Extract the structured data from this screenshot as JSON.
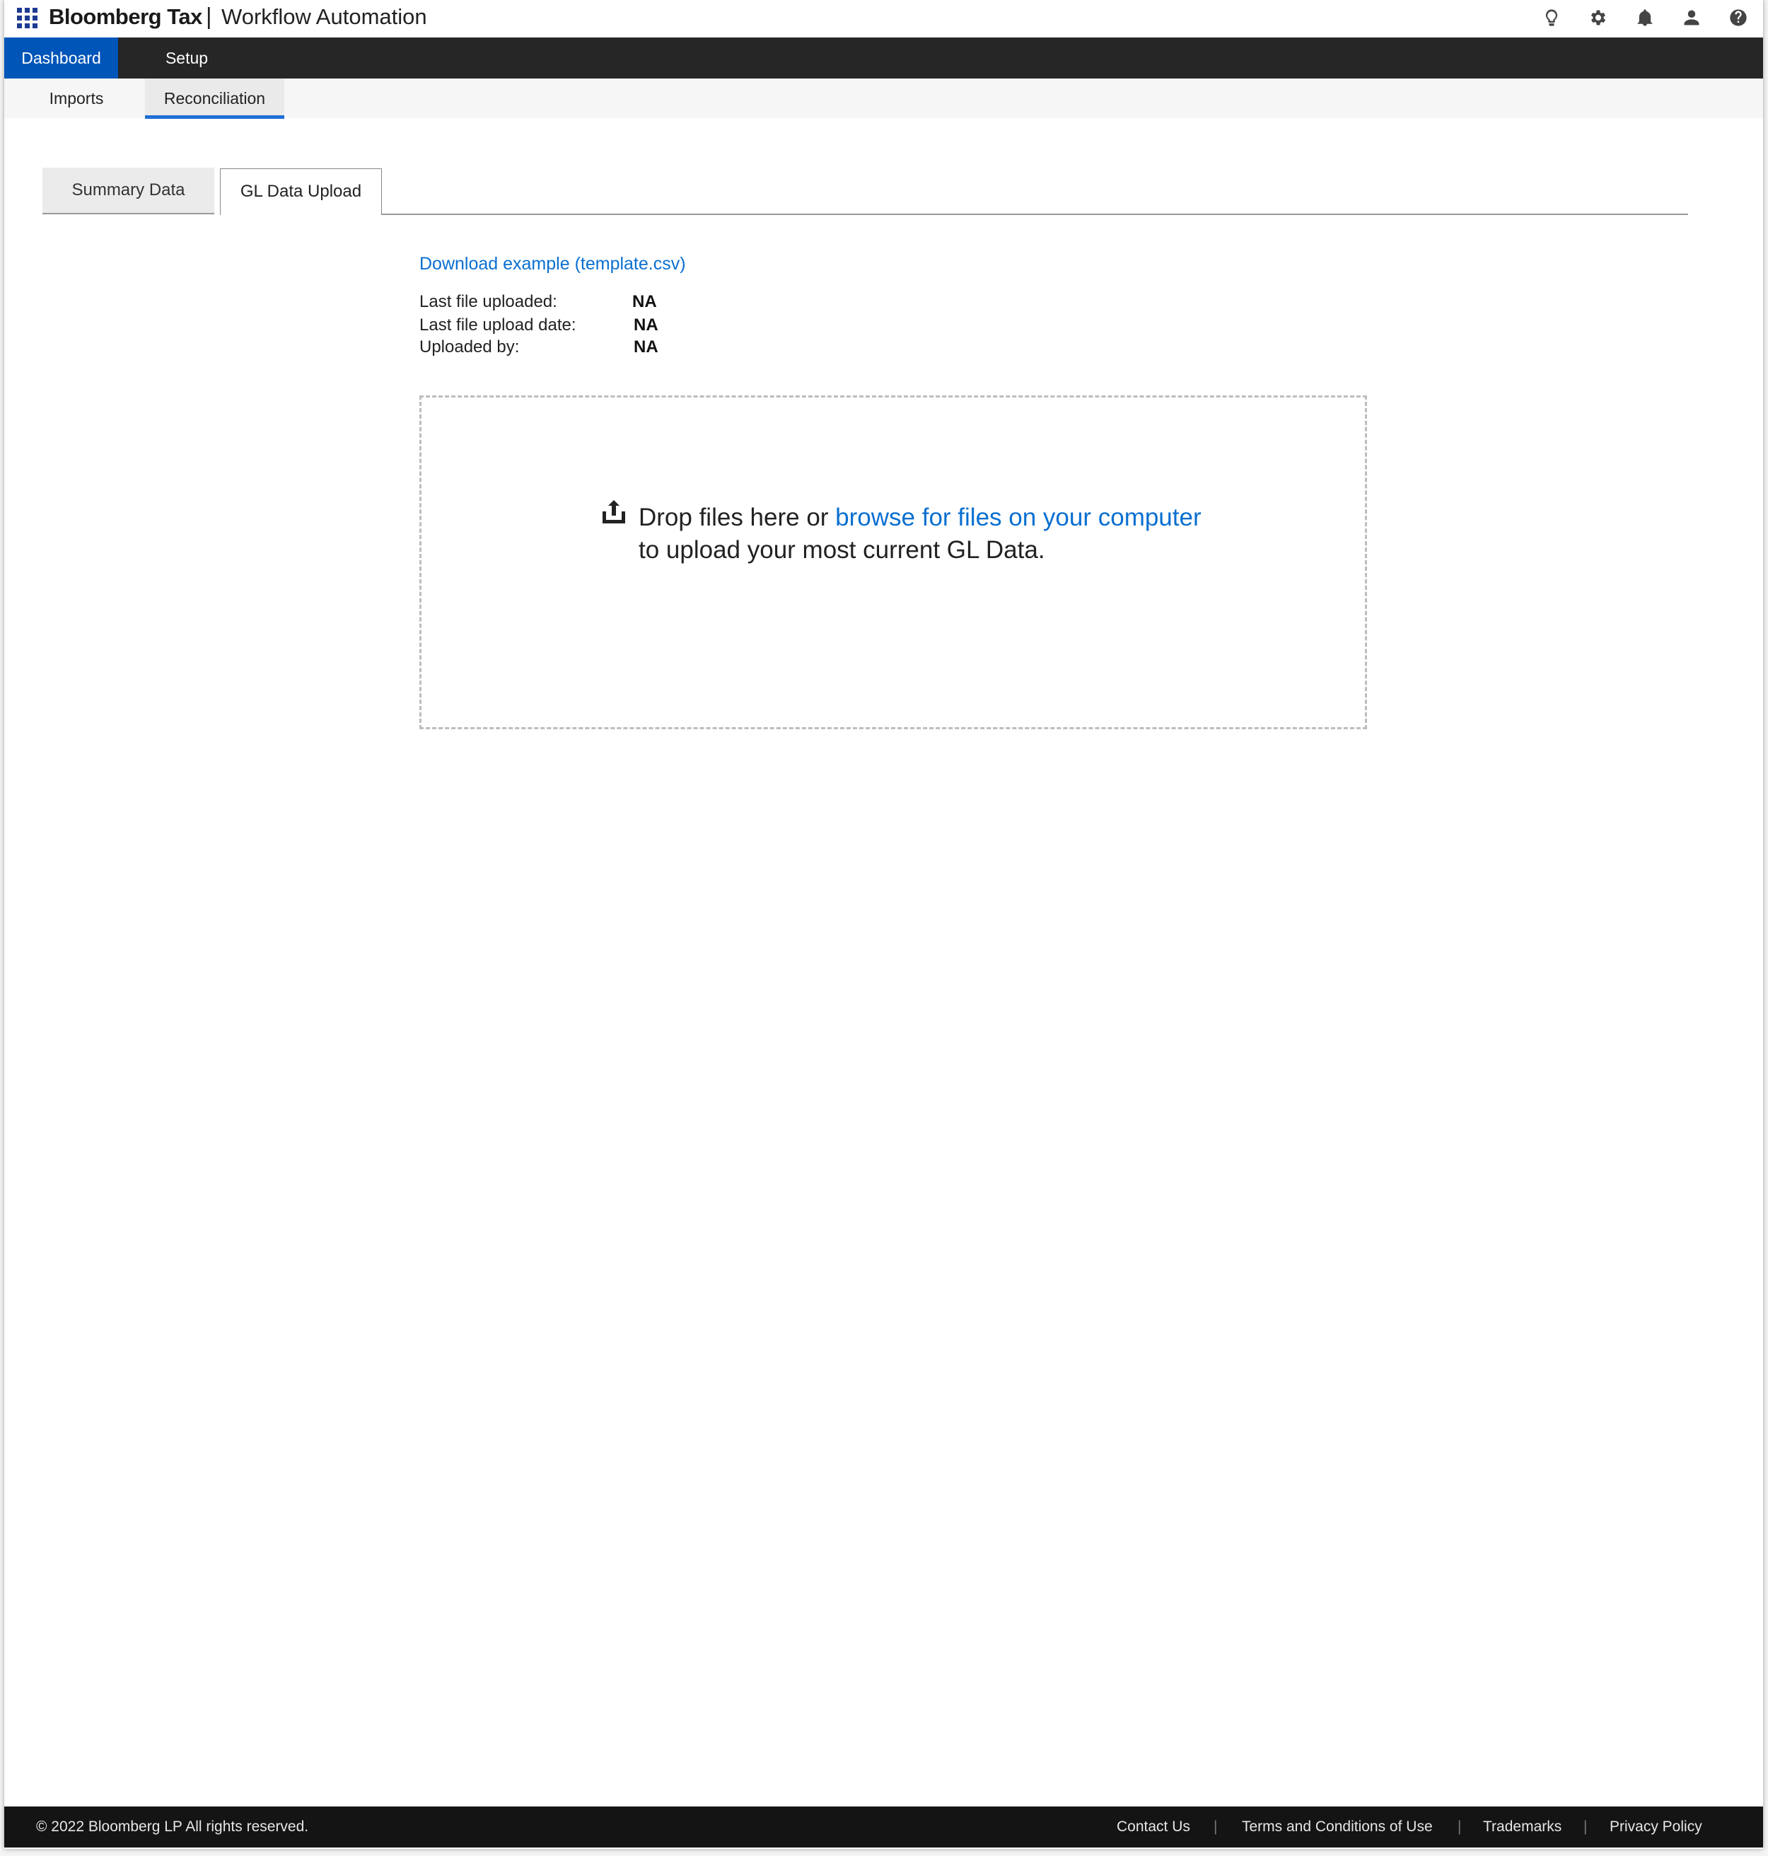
{
  "header": {
    "brand": "Bloomberg Tax",
    "separator": "|",
    "product": "Workflow Automation",
    "icons": [
      "lightbulb-icon",
      "gear-icon",
      "bell-icon",
      "user-icon",
      "help-icon"
    ]
  },
  "primary_nav": {
    "items": [
      {
        "label": "Dashboard",
        "active": true
      },
      {
        "label": "Setup",
        "active": false
      }
    ]
  },
  "sub_nav": {
    "items": [
      {
        "label": "Imports",
        "active": false
      },
      {
        "label": "Reconciliation",
        "active": true
      }
    ]
  },
  "tabs": [
    {
      "label": "Summary Data",
      "active": false
    },
    {
      "label": "GL Data Upload",
      "active": true
    }
  ],
  "upload": {
    "download_link": "Download example (template.csv)",
    "meta": [
      {
        "label": "Last file uploaded:",
        "value": "NA"
      },
      {
        "label": "Last file upload date:",
        "value": "NA"
      },
      {
        "label": "Uploaded by:",
        "value": "NA"
      }
    ],
    "drop_prefix": "Drop files here or ",
    "browse_link": "browse for files on your computer",
    "drop_suffix": "to upload your most current GL Data."
  },
  "footer": {
    "copyright": "© 2022 Bloomberg LP All rights reserved.",
    "links": [
      "Contact Us",
      "Terms and Conditions of Use",
      "Trademarks",
      "Privacy Policy"
    ],
    "separator": "|"
  },
  "colors": {
    "accent": "#0055b8",
    "link": "#0a6fd0",
    "nav_bg": "#262626",
    "footer_bg": "#141414",
    "active_underline": "#1f6fd6"
  }
}
